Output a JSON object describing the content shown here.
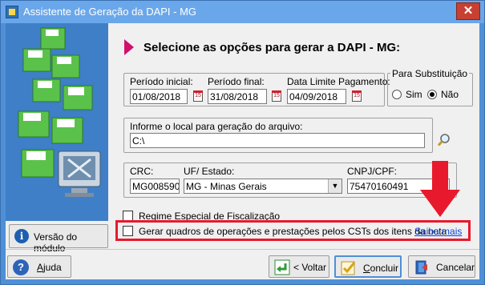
{
  "window": {
    "title": "Assistente de Geração da DAPI - MG",
    "close_label": "✕"
  },
  "left": {
    "version_button": "Versão do módulo"
  },
  "heading": "Selecione as opções para gerar a DAPI - MG:",
  "periodo": {
    "inicial_label": "Período inicial:",
    "inicial_value": "01/08/2018",
    "final_label": "Período final:",
    "final_value": "31/08/2018",
    "limite_label": "Data Limite Pagamento:",
    "limite_value": "04/09/2018"
  },
  "substituicao": {
    "title": "Para Substituição",
    "sim_label": "Sim",
    "nao_label": "Não",
    "selected": "Não"
  },
  "arquivo": {
    "label": "Informe o local para geração do arquivo:",
    "value": "C:\\"
  },
  "contribuinte": {
    "crc_label": "CRC:",
    "crc_value": "MG008590o",
    "uf_label": "UF/ Estado:",
    "uf_value": "MG - Minas Gerais",
    "cnpj_label": "CNPJ/CPF:",
    "cnpj_value": "75470160491"
  },
  "options": {
    "regime_label": "Regime Especial de Fiscalização",
    "quadros_label": "Gerar quadros de operações e prestações pelos CSTs dos itens da nota",
    "saiba_mais": "Saiba mais"
  },
  "buttons": {
    "ajuda_prefix": "",
    "ajuda_u": "A",
    "ajuda_rest": "juda",
    "voltar": "< Voltar",
    "concluir_u": "C",
    "concluir_rest": "oncluir",
    "cancelar": "Cancelar"
  },
  "colors": {
    "titlebar": "#6aa7ea",
    "highlight": "#e8192c",
    "accent_arrow": "#d0106e",
    "link": "#0b46d8"
  }
}
